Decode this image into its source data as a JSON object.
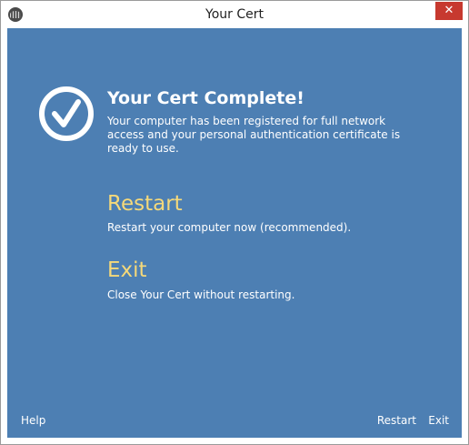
{
  "window": {
    "title": "Your Cert",
    "app_icon": "cert-app-icon",
    "close_label": "✕"
  },
  "main": {
    "status_icon": "checkmark-circle-icon",
    "heading": "Your Cert Complete!",
    "message": "Your computer has been registered for full network access and your personal authentication certificate is ready to use.",
    "options": [
      {
        "title": "Restart",
        "description": "Restart your computer now (recommended)."
      },
      {
        "title": "Exit",
        "description": "Close Your Cert without restarting."
      }
    ]
  },
  "footer": {
    "help_label": "Help",
    "restart_label": "Restart",
    "exit_label": "Exit"
  },
  "colors": {
    "background": "#4d7fb3",
    "option_title": "#f5d97a",
    "text": "#ffffff",
    "close_button": "#c7392f"
  }
}
